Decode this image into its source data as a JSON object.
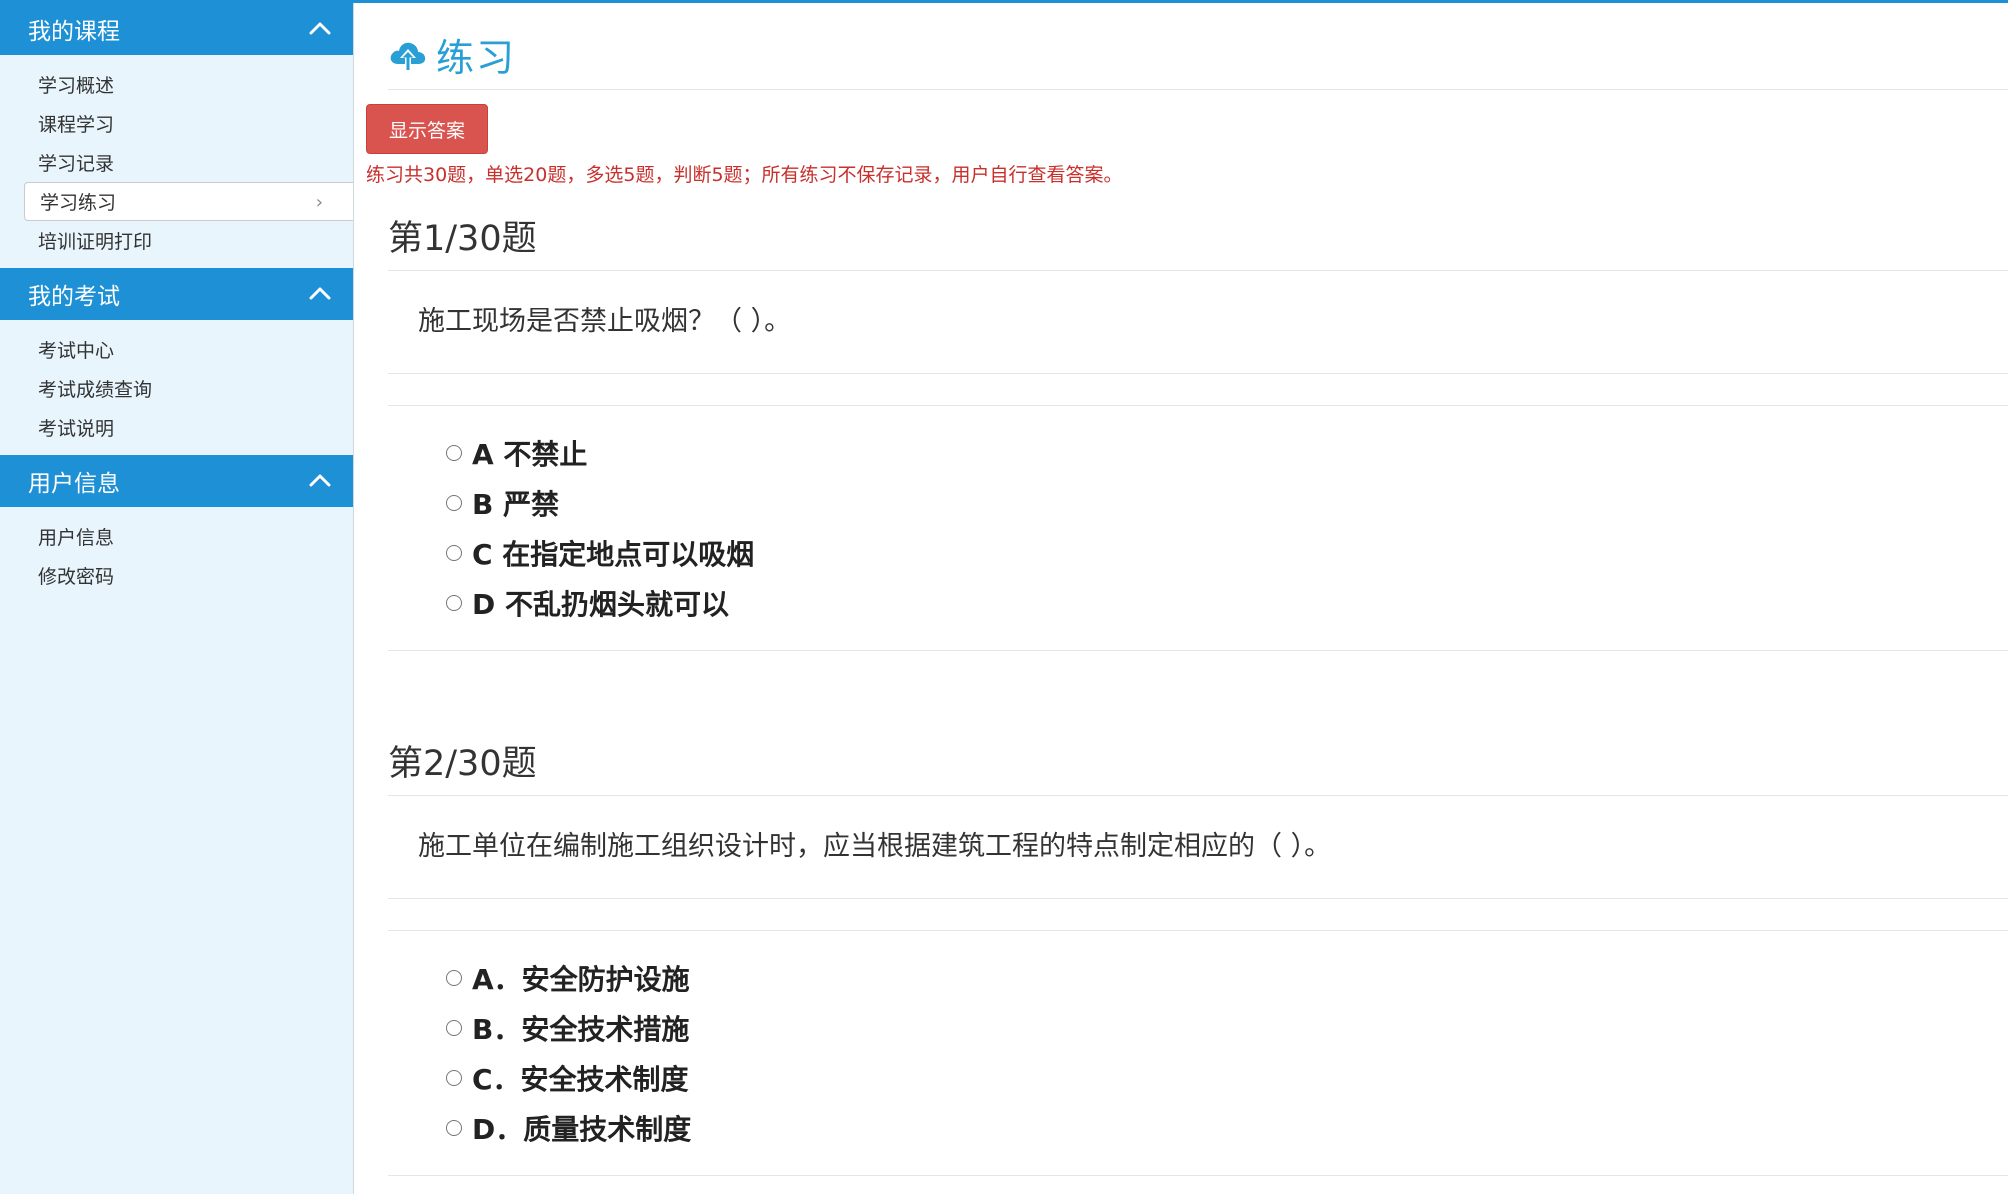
{
  "sidebar": {
    "sections": [
      {
        "title": "我的课程",
        "items": [
          "学习概述",
          "课程学习",
          "学习记录",
          "学习练习",
          "培训证明打印"
        ]
      },
      {
        "title": "我的考试",
        "items": [
          "考试中心",
          "考试成绩查询",
          "考试说明"
        ]
      },
      {
        "title": "用户信息",
        "items": [
          "用户信息",
          "修改密码"
        ]
      }
    ],
    "active_item": "学习练习"
  },
  "main": {
    "title": "练习",
    "title_icon": "cloud-upload-icon",
    "show_answer_label": "显示答案",
    "notice": "练习共30题，单选20题，多选5题，判断5题；所有练习不保存记录，用户自行查看答案。",
    "questions": [
      {
        "heading": "第1/30题",
        "text": "施工现场是否禁止吸烟？（ ）。",
        "options": [
          "A 不禁止",
          "B 严禁",
          "C 在指定地点可以吸烟",
          "D 不乱扔烟头就可以"
        ]
      },
      {
        "heading": "第2/30题",
        "text": "施工单位在编制施工组织设计时，应当根据建筑工程的特点制定相应的（ ）。",
        "options": [
          "A．安全防护设施",
          "B．安全技术措施",
          "C．安全技术制度",
          "D．质量技术制度"
        ]
      }
    ]
  },
  "colors": {
    "accent": "#1e90d6",
    "sidebar_bg": "#e8f5fd",
    "title": "#2a9fd6",
    "danger": "#d9534f",
    "notice_text": "#c9302c"
  }
}
